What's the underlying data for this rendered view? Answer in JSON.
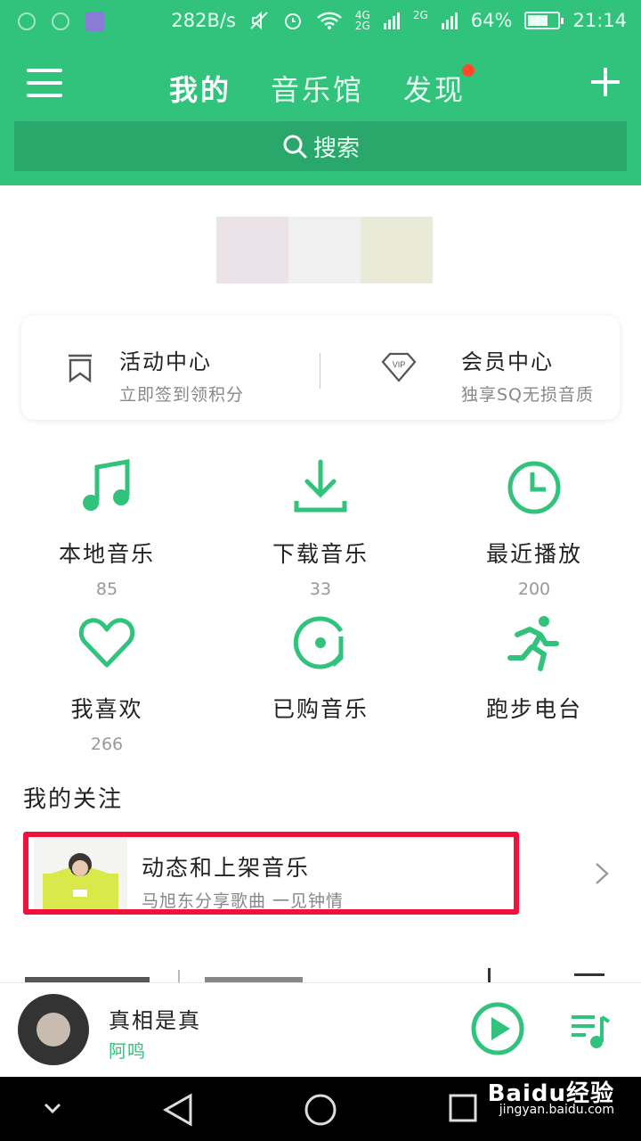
{
  "status_bar": {
    "speed": "282B/s",
    "net_4g": "4G",
    "net_2g_a": "2G",
    "net_2g_b": "2G",
    "battery": "64%",
    "time": "21:14"
  },
  "header": {
    "tabs": [
      {
        "label": "我的",
        "active": true
      },
      {
        "label": "音乐馆",
        "active": false
      },
      {
        "label": "发现",
        "active": false
      }
    ],
    "search_placeholder": "搜索",
    "accent": "#31c27c"
  },
  "banner": {
    "colors": [
      "#ece3e8",
      "#eff0ef",
      "#eaead9"
    ]
  },
  "promo_card": {
    "activity": {
      "title": "活动中心",
      "subtitle": "立即签到领积分"
    },
    "vip": {
      "title": "会员中心",
      "subtitle": "独享SQ无损音质",
      "badge": "VIP"
    }
  },
  "grid": [
    {
      "icon": "music-note-icon",
      "label": "本地音乐",
      "count": "85"
    },
    {
      "icon": "download-icon",
      "label": "下载音乐",
      "count": "33"
    },
    {
      "icon": "clock-icon",
      "label": "最近播放",
      "count": "200"
    },
    {
      "icon": "heart-icon",
      "label": "我喜欢",
      "count": "266"
    },
    {
      "icon": "purchased-disc-icon",
      "label": "已购音乐",
      "count": ""
    },
    {
      "icon": "running-icon",
      "label": "跑步电台",
      "count": ""
    }
  ],
  "follow_section": {
    "title": "我的关注",
    "item": {
      "title": "动态和上架音乐",
      "subtitle": "马旭东分享歌曲  一见钟情"
    }
  },
  "player": {
    "song": "真相是真",
    "artist": "阿鸣"
  },
  "watermark": {
    "brand": "Baidu经验",
    "url": "jingyan.baidu.com"
  }
}
